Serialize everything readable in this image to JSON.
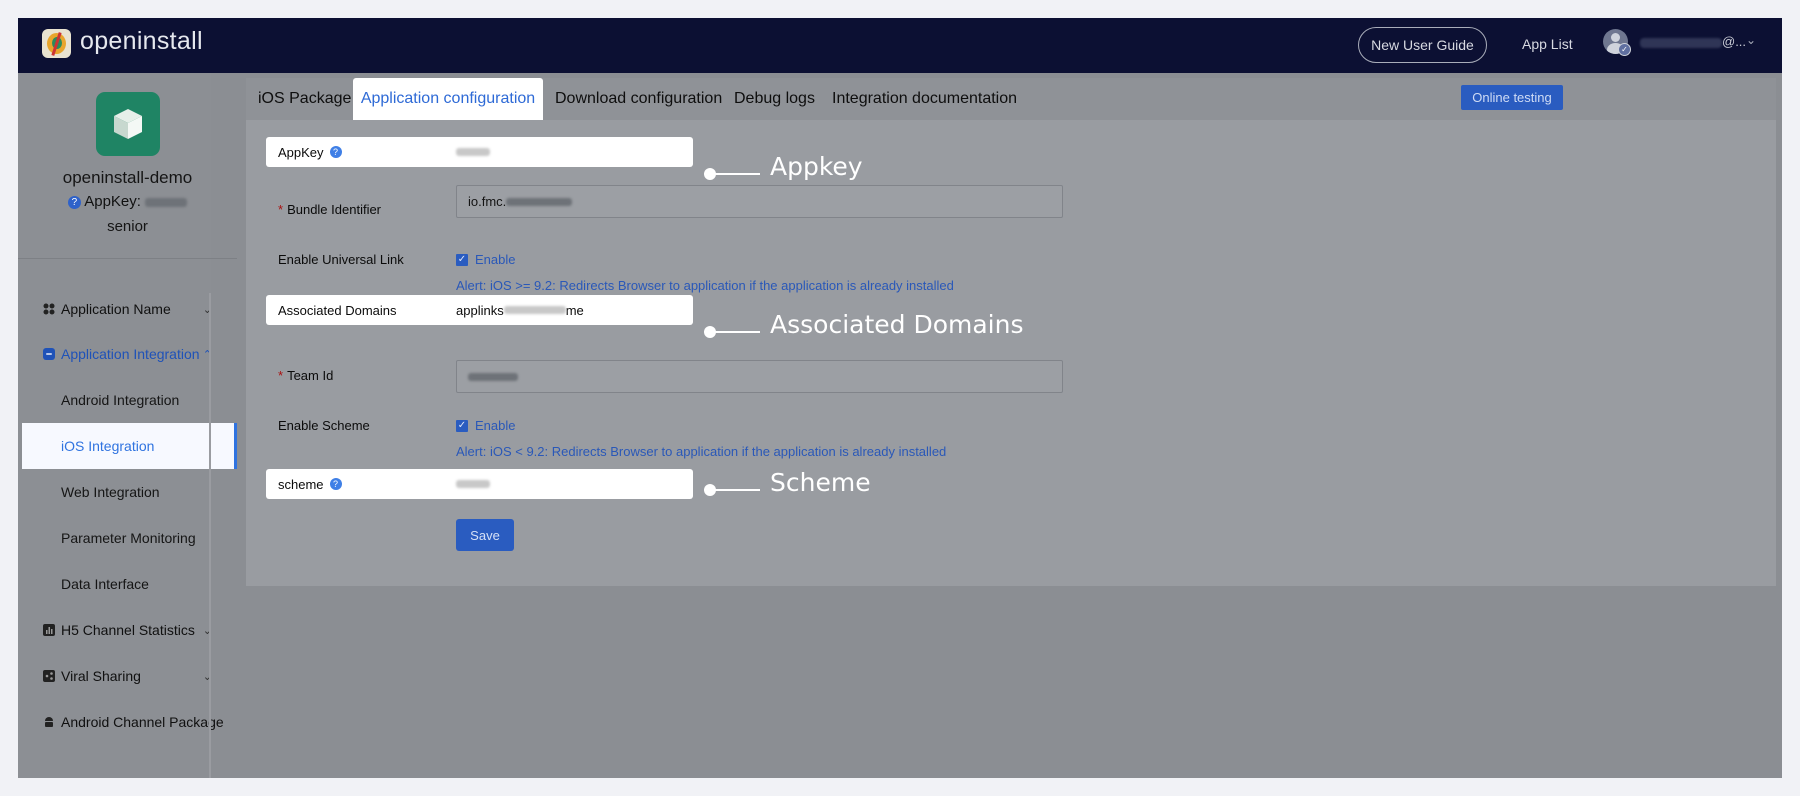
{
  "header": {
    "brand": "openinstall",
    "new_user_guide": "New User Guide",
    "app_list": "App List",
    "user_suffix": "@...",
    "icons": [
      "openinstall-logo",
      "avatar",
      "chevron-down-icon"
    ]
  },
  "sidebar": {
    "app_name": "openinstall-demo",
    "appkey_label": "AppKey:",
    "level": "senior",
    "menu": [
      {
        "label": "Application Name",
        "icon": "grid-icon"
      },
      {
        "label": "Application Integration",
        "icon": "link-icon"
      },
      {
        "label": "H5 Channel Statistics",
        "icon": "chart-icon"
      },
      {
        "label": "Viral Sharing",
        "icon": "share-icon"
      },
      {
        "label": "Android Channel Package",
        "icon": "android-icon"
      }
    ],
    "sub_items": [
      "Android Integration",
      "iOS Integration",
      "Web Integration",
      "Parameter Monitoring",
      "Data Interface"
    ]
  },
  "tabs": [
    "iOS Package",
    "Application configuration",
    "Download configuration",
    "Debug logs",
    "Integration documentation"
  ],
  "online_testing": "Online testing",
  "form": {
    "appkey_label": "AppKey",
    "bundle_label": "Bundle Identifier",
    "bundle_prefix": "io.fmc.",
    "universal_label": "Enable Universal Link",
    "enable": "Enable",
    "alert_universal": "Alert: iOS >= 9.2: Redirects Browser to application if the application is already installed",
    "domains_label": "Associated Domains",
    "domains_prefix": "applinks",
    "domains_suffix": "me",
    "team_label": "Team Id",
    "scheme_enable_label": "Enable Scheme",
    "alert_scheme": "Alert: iOS < 9.2: Redirects Browser to application if the application is already installed",
    "scheme_label": "scheme",
    "save": "Save"
  },
  "annotations": {
    "appkey": "Appkey",
    "domains": "Associated Domains",
    "scheme": "Scheme"
  }
}
